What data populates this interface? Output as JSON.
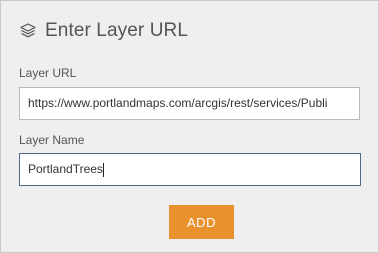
{
  "header": {
    "icon": "layers-icon",
    "title": "Enter Layer URL"
  },
  "form": {
    "url_label": "Layer URL",
    "url_value": "https://www.portlandmaps.com/arcgis/rest/services/Publi",
    "name_label": "Layer Name",
    "name_value": "PortlandTrees"
  },
  "actions": {
    "add_label": "ADD",
    "add_color": "#e8912d"
  }
}
